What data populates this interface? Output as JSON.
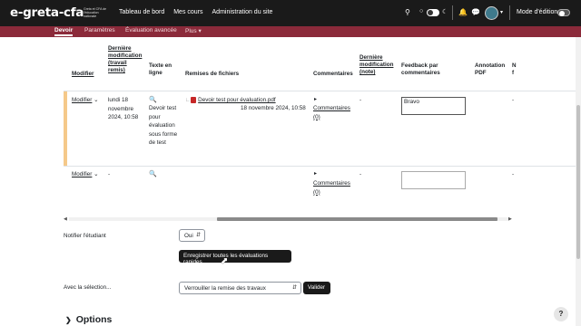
{
  "topbar": {
    "logo": "e-greta-cfa",
    "logo_sub": "Greta et CFA de l'éducation nationale",
    "nav": [
      "Tableau de bord",
      "Mes cours",
      "Administration du site"
    ],
    "mode_edition_label": "Mode d'édition"
  },
  "subnav": {
    "tabs": [
      "Devoir",
      "Paramètres",
      "Évaluation avancée",
      "Plus ▾"
    ],
    "active": "Devoir"
  },
  "table": {
    "headers": {
      "modifier": "Modifier",
      "derniere_modif_travail": "Dernière modification (travail remis)",
      "texte_en_ligne": "Texte en ligne",
      "remises_fichiers": "Remises de fichiers",
      "commentaires": "Commentaires",
      "derniere_modif_note": "Dernière modification (note)",
      "feedback": "Feedback par commentaires",
      "annotation_pdf": "Annotation PDF",
      "truncated": "N f"
    },
    "rows": [
      {
        "modifier": "Modifier",
        "date": "lundi 18 novembre 2024, 10:58",
        "texte": "Devoir test pour évaluation sous forme de test",
        "file_name": "Devoir test pour évaluation.pdf",
        "file_date": "18 novembre 2024, 10:58",
        "commentaires": "Commentaires (0)",
        "note_date": "-",
        "feedback": "Bravo",
        "annotation": "-"
      },
      {
        "modifier": "Modifier",
        "date": "-",
        "texte": "",
        "file_name": "",
        "file_date": "",
        "commentaires": "Commentaires (0)",
        "note_date": "-",
        "feedback": "",
        "annotation": "-"
      }
    ]
  },
  "notify": {
    "label": "Notifier l'étudiant",
    "value": "Oui"
  },
  "save_quick_label": "Enregistrer toutes les évaluations rapides",
  "bulk": {
    "label": "Avec la sélection...",
    "value": "Verrouiller la remise des travaux",
    "button": "Valider"
  },
  "options_label": "Options",
  "help_label": "?"
}
